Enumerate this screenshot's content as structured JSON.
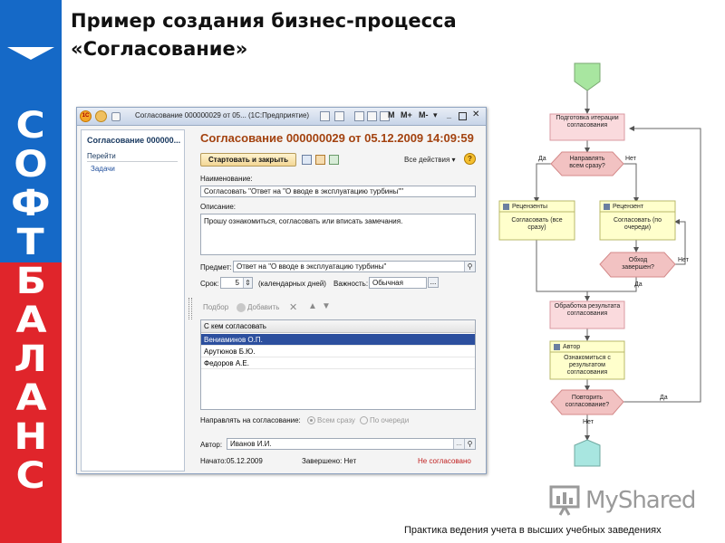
{
  "slide": {
    "title_line1": "Пример создания бизнес-процесса",
    "title_line2": "«Согласование»",
    "footer": "Практика ведения учета в высших учебных заведениях",
    "watermark": "MyShared"
  },
  "brand": {
    "letters": [
      "С",
      "О",
      "Ф",
      "Т",
      "Б",
      "А",
      "Л",
      "А",
      "Н",
      "С"
    ],
    "colors": {
      "top": "#1569c7",
      "bottom": "#e0252b"
    }
  },
  "window": {
    "logo": "1С",
    "title": "Согласование 000000029 от 05... (1С:Предприятие)",
    "toolbar_m": "M",
    "toolbar_mplus": "M+",
    "toolbar_mminus": "M-",
    "left_panel": {
      "title": "Согласование 000000...",
      "goto": "Перейти",
      "tasks": "Задачи"
    },
    "form": {
      "title": "Согласование 000000029 от 05.12.2009 14:09:59",
      "start_close_button": "Стартовать и закрыть",
      "all_actions": "Все действия",
      "help": "?",
      "name_label": "Наименование:",
      "name_value": "Согласовать \"Ответ на \"О вводе в эксплуатацию турбины\"\"",
      "description_label": "Описание:",
      "description_value": "Прошу ознакомиться, согласовать или вписать замечания.",
      "subject_label": "Предмет:",
      "subject_value": "Ответ на \"О вводе в эксплуатацию турбины\"",
      "term_label": "Срок:",
      "term_value": "5",
      "term_unit": "(календарных дней)",
      "importance_label": "Важность:",
      "importance_value": "Обычная",
      "dots": "...",
      "pick_label": "Подбор",
      "add_label": "Добавить",
      "table_header": "С кем согласовать",
      "table_rows": [
        "Вениаминов О.П.",
        "Арутюнов Б.Ю.",
        "Федоров А.Е."
      ],
      "direction_label": "Направлять на согласование:",
      "direction_opt1": "Всем сразу",
      "direction_opt2": "По очереди",
      "author_label": "Автор:",
      "author_value": "Иванов И.И.",
      "started_label": "Начато:",
      "started_value": "05.12.2009",
      "finished_label": "Завершено:",
      "finished_value": "Нет",
      "status": "Не согласовано"
    }
  },
  "flowchart": {
    "prepare": "Подготовка итерации согласования",
    "send_all": "Направлять всем сразу?",
    "yes": "Да",
    "no": "Нет",
    "reviewers": "Рецензенты",
    "approve_all": "Согласовать (все сразу)",
    "reviewer": "Рецензент",
    "approve_queue": "Согласовать (по очереди)",
    "round_done": "Обход завершен?",
    "process_result": "Обработка результата согласования",
    "author": "Автор",
    "acquaint": "Ознакомиться с результатом согласования",
    "repeat": "Повторить согласование?",
    "colors": {
      "task": "#fadadd",
      "task_border": "#d99aa1",
      "user": "#ffffcc",
      "user_border": "#b9b96a",
      "start": "#a8e6a0",
      "end": "#a8e6e0"
    }
  }
}
